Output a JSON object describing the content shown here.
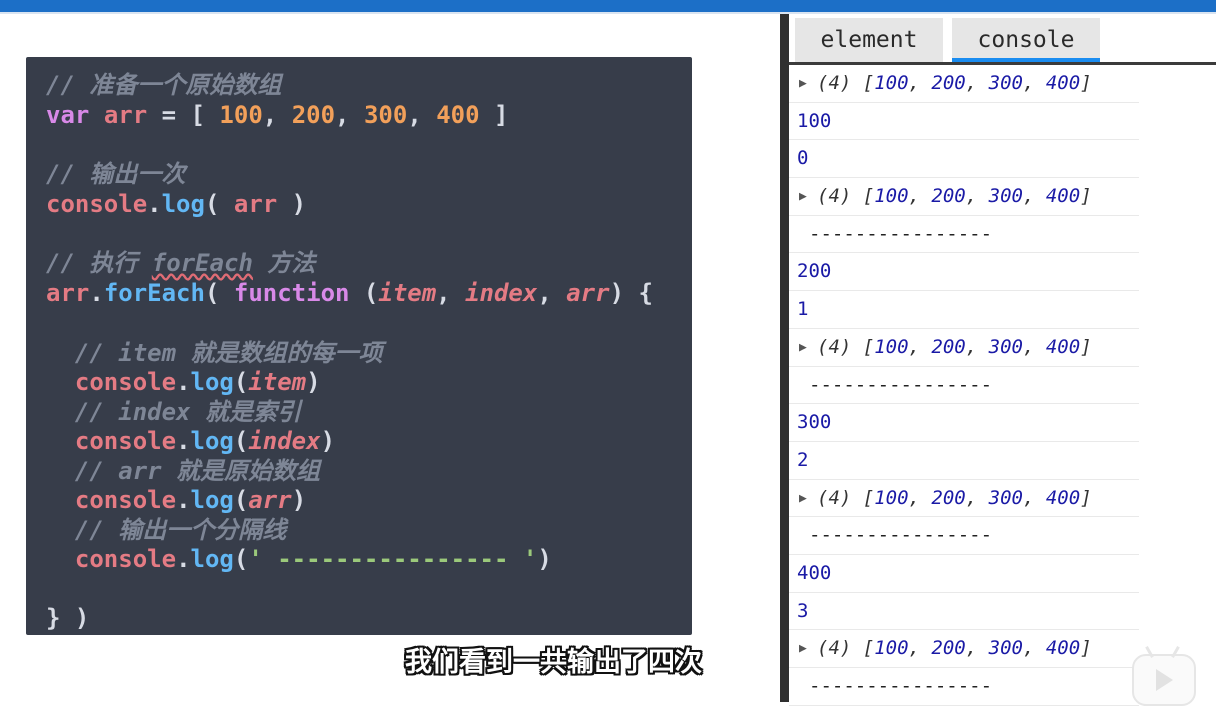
{
  "code": {
    "comment1": "// 准备一个原始数组",
    "var_kw": "var",
    "arr_name": "arr",
    "eq": " = [ ",
    "nums": [
      "100",
      "200",
      "300",
      "400"
    ],
    "arr_close": " ]",
    "comment2": "// 输出一次",
    "console_name": "console",
    "log_name": "log",
    "comment3_pre": "// 执行 ",
    "comment3_word": "forEach",
    "comment3_post": " 方法",
    "foreach_name": "forEach",
    "function_kw": "function",
    "params": [
      "item",
      "index",
      "arr"
    ],
    "comment4": "// item 就是数组的每一项",
    "comment5": "// index 就是索引",
    "comment6": "// arr 就是原始数组",
    "comment7": "// 输出一个分隔线",
    "separator_string": "' ---------------- '",
    "close_brace": "} )"
  },
  "caption": "我们看到一共输出了四次",
  "devtools": {
    "tabs": [
      {
        "label": "element",
        "active": false
      },
      {
        "label": "console",
        "active": true
      }
    ],
    "array_prefix": "(4) [",
    "array_values": [
      "100",
      "200",
      "300",
      "400"
    ],
    "array_suffix": "]",
    "separator": "----------------",
    "items": [
      "100",
      "200",
      "300",
      "400"
    ],
    "indices": [
      "0",
      "1",
      "2",
      "3"
    ]
  },
  "colors": {
    "topbar": "#1c6fc7",
    "code_bg": "#373d4a",
    "tab_accent": "#1a8cf0"
  },
  "icons": [
    "disclosure-triangle-icon",
    "play-badge-icon"
  ]
}
